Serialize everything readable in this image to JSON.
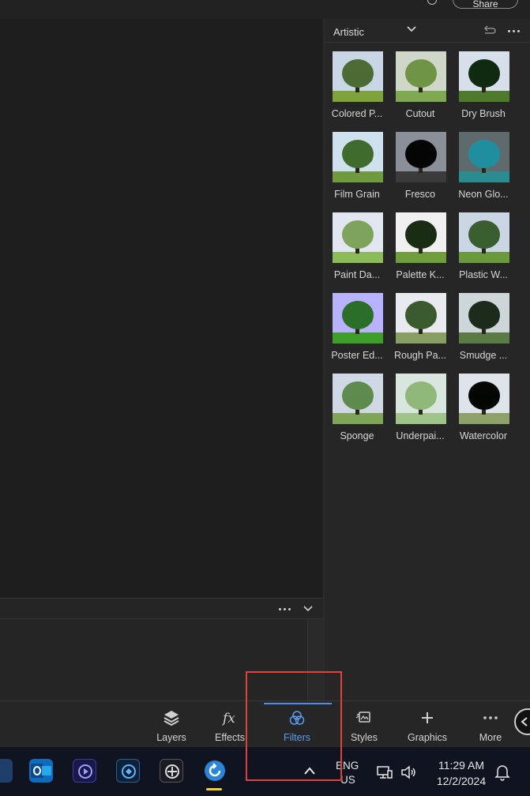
{
  "top": {
    "share_label": "Share"
  },
  "filters": {
    "category": "Artistic",
    "items": [
      {
        "label": "Colored P..."
      },
      {
        "label": "Cutout"
      },
      {
        "label": "Dry Brush"
      },
      {
        "label": "Film Grain"
      },
      {
        "label": "Fresco"
      },
      {
        "label": "Neon Glo..."
      },
      {
        "label": "Paint Da..."
      },
      {
        "label": "Palette K..."
      },
      {
        "label": "Plastic W..."
      },
      {
        "label": "Poster Ed..."
      },
      {
        "label": "Rough Pa..."
      },
      {
        "label": "Smudge ..."
      },
      {
        "label": "Sponge"
      },
      {
        "label": "Underpai..."
      },
      {
        "label": "Watercolor"
      }
    ]
  },
  "toolbar": {
    "items": [
      {
        "label": "Layers",
        "icon": "layers-icon"
      },
      {
        "label": "Effects",
        "icon": "fx-icon"
      },
      {
        "label": "Filters",
        "icon": "filters-icon",
        "active": true
      },
      {
        "label": "Styles",
        "icon": "styles-icon"
      },
      {
        "label": "Graphics",
        "icon": "plus-icon"
      },
      {
        "label": "More",
        "icon": "more-icon"
      }
    ]
  },
  "taskbar": {
    "language_line1": "ENG",
    "language_line2": "US",
    "time": "11:29 AM",
    "date": "12/2/2024"
  },
  "colors": {
    "accent": "#4b8ef0",
    "highlight": "#e0413c"
  }
}
